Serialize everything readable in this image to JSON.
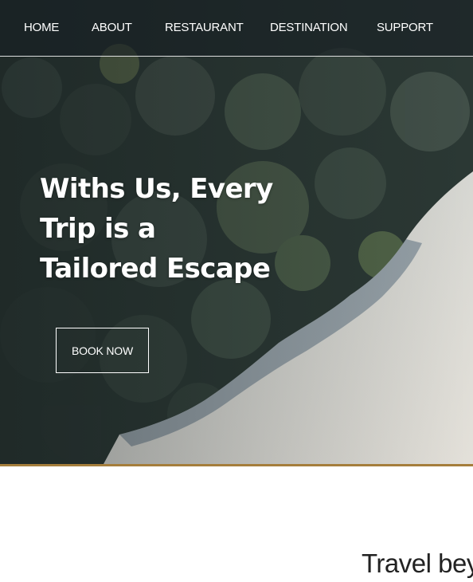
{
  "nav": {
    "items": [
      {
        "label": "HOME"
      },
      {
        "label": "ABOUT"
      },
      {
        "label": "RESTAURANT"
      },
      {
        "label": "DESTINATION"
      },
      {
        "label": "SUPPORT"
      }
    ]
  },
  "hero": {
    "headline_lines": [
      "Withs Us, Every",
      "Trip is a",
      "Tailored Escape"
    ],
    "cta_label": "BOOK NOW"
  },
  "section": {
    "title": "Travel bey"
  },
  "colors": {
    "accent_gold": "#a57e3c",
    "forest": "#2d3a35",
    "sand": "#d9d6cf"
  }
}
